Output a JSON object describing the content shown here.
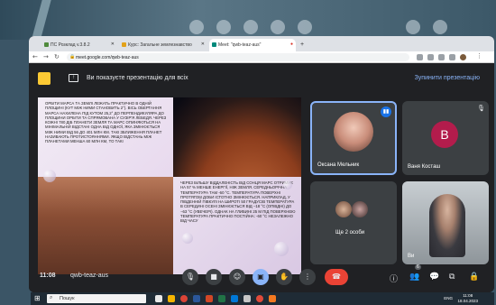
{
  "browser": {
    "tabs": [
      {
        "label": "ПС Розклад v.3.8.2",
        "color": "#4f8a3c"
      },
      {
        "label": "Курс: Загальне землезнавство",
        "color": "#e3a21a"
      },
      {
        "label": "Meet: \"qwb-teaz-aus\"",
        "color": "#00897b"
      }
    ],
    "url": "meet.google.com/qwb-teaz-aus",
    "new_tab": "+"
  },
  "banner": {
    "text": "Ви показуєте презентацію для всіх",
    "stop_label": "Зупинити презентацію"
  },
  "slide": {
    "text1": "ОРБІТИ МАРСА ТА ЗЕМЛІ ЛЕЖАТЬ ПРАКТИЧНО В ОДНІЙ ПЛОЩИНІ (КУТ МІЖ НИМИ СТАНОВИТЬ 2°). ВІСЬ ОБЕРТАННЯ МАРСА НАХИЛЕНА ПІД КУТОМ 25,2° ДО ПЕРПЕНДИКУЛЯРА ДО ПЛОЩИНИ ОРБІТИ ТА СПРЯМОВАНА У СУЗІР'Я ЛЕБЕДЯ. ЧЕРЕЗ КОЖНІ 780 ДІБ ПЛАНЕТИ ЗЕМЛЯ ТА МАРС ОПИНЯЮТЬСЯ НА МІНІМАЛЬНІЙ ВІДСТАНІ ОДНА ВІД ОДНОЇ, ЯКА ЗМІНЮЄТЬСЯ МІЖ НИМИ ВІД 56 ДО 401 МЛН КМ. ТАКІ ЗБЛИЖЕННЯ ПЛАНЕТ НАЗИВАЮТЬ ПРОТИСТОЯННЯМИ. ЯКЩО ВІДСТАНЬ МІЖ ПЛАНЕТАМИ МЕНША 60 МЛН КМ, ТО ТАКІ",
    "text2": "ЧЕРЕЗ БІЛЬШУ ВІДДАЛЕНІСТЬ ВІД СОНЦЯ МАРС ОТРИМУЄ НА 57 % МЕНШЕ ЕНЕРГІЇ, НІЖ ЗЕМЛЯ. СЕРЕДНЬОРІЧНА ТЕМПЕРАТУРА ТАМ -60 °С. ТЕМПЕРАТУРА ПОВЕРХНІ ПРОТЯГОМ ДОБИ ІСТОТНО ЗМІНЮЄТЬСЯ. НАПРИКЛАД, У ПІВДЕННІЙ ПІВКУЛІ НА ШИРОТІ 50 ГРАДУСІВ ТЕМПЕРАТУРА В СЕРЕДИНІ ОСЕНІ ЗМІНЮЄТЬСЯ ВІД −18 °C (ОПІВДНІ) ДО −63 °C (УВЕЧЕРІ). ОДНАК НА ГЛИБИНІ 25 М ПІД ПОВЕРХНЕЮ ТЕМПЕРАТУРА ПРАКТИЧНО ПОСТІЙНА: -60 °С НЕЗАЛЕЖНО ВІД ЧАСУ"
  },
  "participants": {
    "oksana": {
      "name": "Оксана Мельник"
    },
    "vanya": {
      "name": "Ваня Косташ",
      "initial": "B",
      "avatar_color": "#b31c4c"
    },
    "others": {
      "name": "Ще 2 особи"
    },
    "vi": {
      "name": "Ви"
    }
  },
  "controls": {
    "time": "11:08",
    "meeting_code": "qwb-teaz-aus",
    "participant_badge": "6"
  },
  "taskbar": {
    "search_placeholder": "Пошук",
    "lang": "ENG",
    "time": "11:08",
    "date": "18.04.2023"
  }
}
